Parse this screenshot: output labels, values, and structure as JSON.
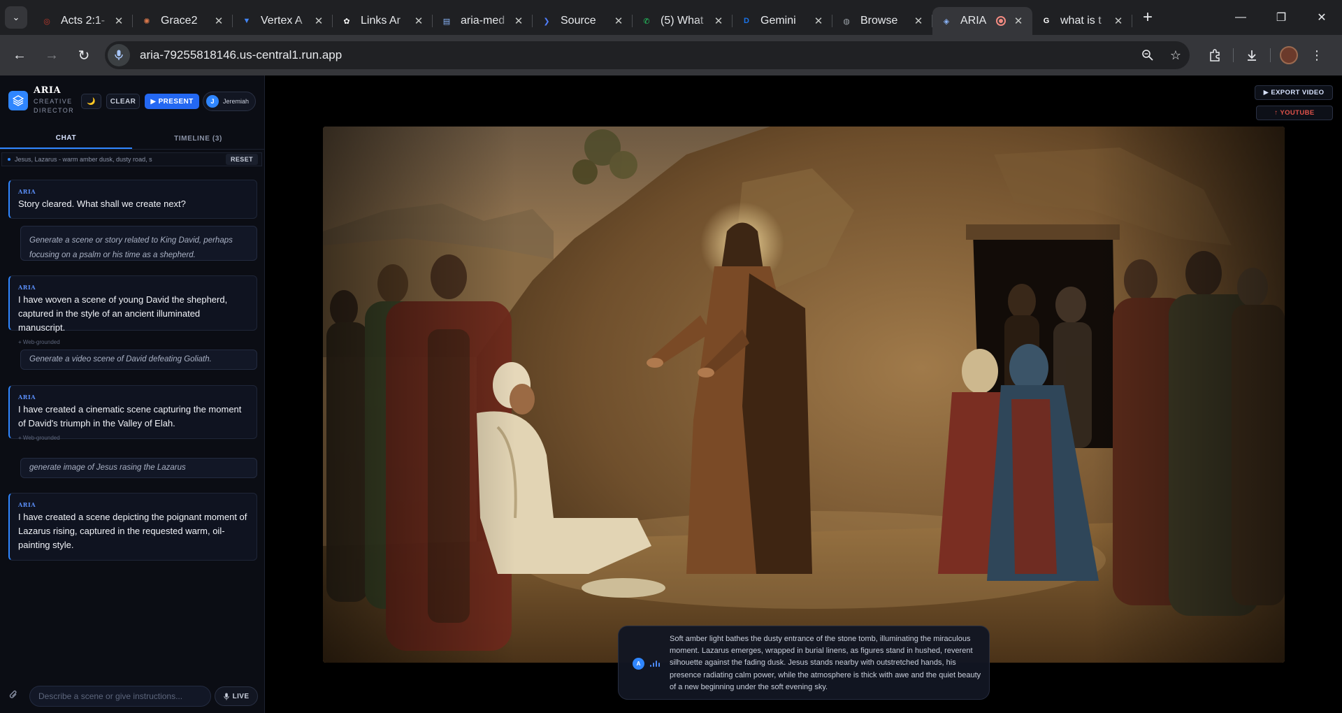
{
  "browser": {
    "tabs": [
      {
        "title": "Acts 2:1-",
        "icon": "bible-app-icon",
        "color": "#c0392b"
      },
      {
        "title": "Grace2",
        "icon": "claude-icon",
        "color": "#d9774b"
      },
      {
        "title": "Vertex A",
        "icon": "vertex-ai-icon",
        "color": "#4285f4"
      },
      {
        "title": "Links Ar",
        "icon": "chatgpt-icon",
        "color": "#ffffff"
      },
      {
        "title": "aria-med",
        "icon": "cloud-console-icon",
        "color": "#8ab4f8"
      },
      {
        "title": "Source",
        "icon": "source-icon",
        "color": "#4f7df9"
      },
      {
        "title": "(5) What",
        "icon": "whatsapp-icon",
        "color": "#25d366"
      },
      {
        "title": "Gemini",
        "icon": "gemini-icon",
        "color": "#1a73e8"
      },
      {
        "title": "Browse",
        "icon": "globe-icon",
        "color": "#9aa0a6"
      },
      {
        "title": "ARIA",
        "icon": "aria-icon",
        "color": "#8ab4f8",
        "active": true
      },
      {
        "title": "what is t",
        "icon": "google-icon",
        "color": "#ffffff"
      }
    ],
    "url": "aria-79255818146.us-central1.run.app"
  },
  "app": {
    "brand_name": "ARIA",
    "brand_sub": "CREATIVE DIRECTOR",
    "theme_icon": "🌙",
    "clear_label": "CLEAR",
    "present_label": "▶ PRESENT",
    "user_initial": "J",
    "user_name": "Jeremiah",
    "tabs": {
      "chat": "CHAT",
      "timeline": "TIMELINE (3)"
    },
    "context_text": "Jesus, Lazarus - warm amber dusk, dusty road, s",
    "reset_label": "RESET",
    "messages": [
      {
        "role": "ARIA",
        "text": "Story cleared. What shall we create next?"
      },
      {
        "role": "user",
        "text": "Generate a scene or story related to King David, perhaps focusing on a psalm or his time as a shepherd."
      },
      {
        "role": "ARIA",
        "text": "I have woven a scene of young David the shepherd, captured in the style of an ancient illuminated manuscript.",
        "grounded": "+ Web-grounded"
      },
      {
        "role": "user",
        "text": "Generate a video scene of David defeating Goliath."
      },
      {
        "role": "ARIA",
        "text": "I have created a cinematic scene capturing the moment of David's triumph in the Valley of Elah.",
        "grounded": "+ Web-grounded"
      },
      {
        "role": "user",
        "text": "generate image of Jesus rasing the Lazarus"
      },
      {
        "role": "ARIA",
        "text": "I have created a scene depicting the poignant moment of Lazarus rising, captured in the requested warm, oil-painting style."
      }
    ],
    "composer_placeholder": "Describe a scene or give instructions...",
    "live_label": "LIVE",
    "export_label": "▶ EXPORT VIDEO",
    "youtube_label": "↑ YOUTUBE",
    "caption_initial": "A",
    "caption": "Soft amber light bathes the dusty entrance of the stone tomb, illuminating the miraculous moment. Lazarus emerges, wrapped in burial linens, as figures stand in hushed, reverent silhouette against the fading dusk. Jesus stands nearby with outstretched hands, his presence radiating calm power, while the atmosphere is thick with awe and the quiet beauty of a new beginning under the soft evening sky.",
    "accent": "#2f86ff"
  }
}
